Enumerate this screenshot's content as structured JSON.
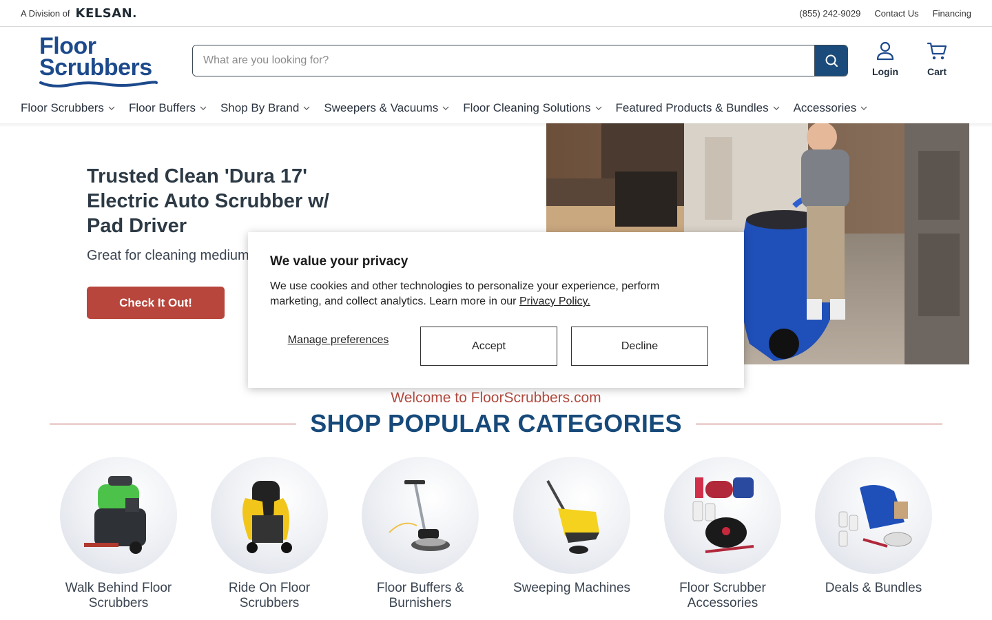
{
  "utility": {
    "division_prefix": "A Division of",
    "division_brand": "KELSAN",
    "phone": "(855) 242-9029",
    "contact": "Contact Us",
    "financing": "Financing"
  },
  "header": {
    "logo_line1": "Floor",
    "logo_line2": "Scrubbers",
    "search_placeholder": "What are you looking for?",
    "login_label": "Login",
    "cart_label": "Cart"
  },
  "nav": {
    "items": [
      {
        "label": "Floor Scrubbers"
      },
      {
        "label": "Floor Buffers"
      },
      {
        "label": "Shop By Brand"
      },
      {
        "label": "Sweepers & Vacuums"
      },
      {
        "label": "Floor Cleaning Solutions"
      },
      {
        "label": "Featured Products & Bundles"
      },
      {
        "label": "Accessories"
      }
    ]
  },
  "hero": {
    "title": "Trusted Clean 'Dura 17' Electric Auto Scrubber w/ Pad Driver",
    "subtitle": "Great for cleaning medium",
    "cta": "Check It Out!"
  },
  "categories": {
    "welcome": "Welcome to FloorScrubbers.com",
    "heading": "SHOP POPULAR CATEGORIES",
    "items": [
      {
        "label": "Walk Behind Floor Scrubbers",
        "icon": "walk-behind-scrubber-image"
      },
      {
        "label": "Ride On Floor Scrubbers",
        "icon": "ride-on-scrubber-image"
      },
      {
        "label": "Floor Buffers & Burnishers",
        "icon": "floor-buffer-image"
      },
      {
        "label": "Sweeping Machines",
        "icon": "sweeper-image"
      },
      {
        "label": "Floor Scrubber Accessories",
        "icon": "accessories-image"
      },
      {
        "label": "Deals & Bundles",
        "icon": "bundle-image"
      }
    ]
  },
  "cookie": {
    "title": "We value your privacy",
    "text": "We use cookies and other technologies to personalize your experience, perform marketing, and collect analytics. Learn more in our ",
    "link": "Privacy Policy.",
    "manage": "Manage preferences",
    "accept": "Accept",
    "decline": "Decline"
  },
  "colors": {
    "brand_blue": "#1d4a8c",
    "accent_red": "#b8463c",
    "search_button": "#1b4b7a"
  }
}
